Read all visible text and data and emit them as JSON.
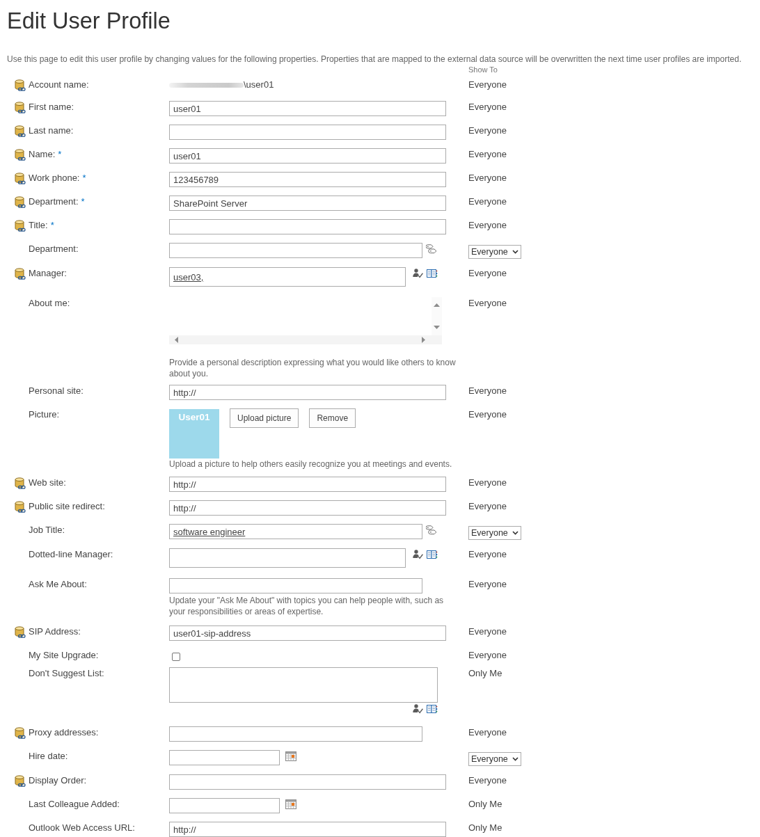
{
  "page": {
    "title": "Edit User Profile",
    "description": "Use this page to edit this user profile by changing values for the following properties. Properties that are mapped to the external data source will be overwritten the next time user profiles are imported.",
    "show_to_heading": "Show To"
  },
  "rows": [
    {
      "kind": "static",
      "label": "Account name:",
      "mapped": true,
      "redacted": true,
      "value": "\\user01",
      "visibility": "Everyone",
      "visibility_editable": false
    },
    {
      "kind": "text",
      "label": "First name:",
      "mapped": true,
      "value": "user01",
      "visibility": "Everyone",
      "visibility_editable": false
    },
    {
      "kind": "text",
      "label": "Last name:",
      "mapped": true,
      "visibility": "Everyone",
      "visibility_editable": false
    },
    {
      "kind": "text",
      "label": "Name:",
      "required_mark": "*",
      "mapped": true,
      "value": "user01",
      "visibility": "Everyone",
      "visibility_editable": false
    },
    {
      "kind": "text",
      "label": "Work phone:",
      "required_mark": "*",
      "mapped": true,
      "value": "123456789",
      "visibility": "Everyone",
      "visibility_editable": false
    },
    {
      "kind": "text",
      "label": "Department:",
      "required_mark": "*",
      "mapped": true,
      "value": "SharePoint Server",
      "visibility": "Everyone",
      "visibility_editable": false
    },
    {
      "kind": "text",
      "label": "Title:",
      "required_mark": "*",
      "mapped": true,
      "visibility": "Everyone",
      "visibility_editable": false
    },
    {
      "kind": "taxonomy",
      "label": "Department:",
      "mapped": false,
      "visibility": "Everyone",
      "visibility_editable": true
    },
    {
      "kind": "people",
      "label": "Manager:",
      "mapped": true,
      "value": "user03,",
      "resolved": true,
      "visibility": "Everyone",
      "visibility_editable": false
    },
    {
      "kind": "note",
      "label": "About me:",
      "mapped": false,
      "help": "Provide a personal description expressing what you would like others to know about you.",
      "visibility": "Everyone",
      "visibility_editable": false
    },
    {
      "kind": "text",
      "label": "Personal site:",
      "mapped": false,
      "value": "http://",
      "visibility": "Everyone",
      "visibility_editable": false
    },
    {
      "kind": "picture",
      "label": "Picture:",
      "mapped": false,
      "picture_label": "User01",
      "buttons": [
        "Upload picture",
        "Remove"
      ],
      "help": "Upload a picture to help others easily recognize you at meetings and events.",
      "visibility": "Everyone",
      "visibility_editable": false
    },
    {
      "kind": "text",
      "label": "Web site:",
      "mapped": true,
      "value": "http://",
      "visibility": "Everyone",
      "visibility_editable": false
    },
    {
      "kind": "text",
      "label": "Public site redirect:",
      "mapped": true,
      "value": "http://",
      "visibility": "Everyone",
      "visibility_editable": false
    },
    {
      "kind": "taxonomy",
      "label": "Job Title:",
      "mapped": false,
      "value": "software engineer",
      "resolved": true,
      "visibility": "Everyone",
      "visibility_editable": true
    },
    {
      "kind": "people",
      "label": "Dotted-line Manager:",
      "mapped": false,
      "visibility": "Everyone",
      "visibility_editable": false
    },
    {
      "kind": "multi",
      "label": "Ask Me About:",
      "mapped": false,
      "help": "Update your \"Ask Me About\" with topics you can help people with, such as your responsibilities or areas of expertise.",
      "visibility": "Everyone",
      "visibility_editable": false
    },
    {
      "kind": "text",
      "label": "SIP Address:",
      "mapped": true,
      "value": "user01-sip-address",
      "visibility": "Everyone",
      "visibility_editable": false
    },
    {
      "kind": "checkbox",
      "label": "My Site Upgrade:",
      "mapped": false,
      "checked": false,
      "visibility": "Everyone",
      "visibility_editable": false
    },
    {
      "kind": "people_box",
      "label": "Don't Suggest List:",
      "mapped": false,
      "visibility": "Only Me",
      "visibility_editable": false
    },
    {
      "kind": "multi",
      "label": "Proxy addresses:",
      "mapped": true,
      "visibility": "Everyone",
      "visibility_editable": false
    },
    {
      "kind": "date",
      "label": "Hire date:",
      "mapped": false,
      "visibility": "Everyone",
      "visibility_editable": true
    },
    {
      "kind": "text",
      "label": "Display Order:",
      "mapped": true,
      "visibility": "Everyone",
      "visibility_editable": false
    },
    {
      "kind": "date",
      "label": "Last Colleague Added:",
      "mapped": false,
      "visibility": "Only Me",
      "visibility_editable": false
    },
    {
      "kind": "text",
      "label": "Outlook Web Access URL:",
      "mapped": false,
      "value": "http://",
      "visibility": "Only Me",
      "visibility_editable": false
    }
  ]
}
